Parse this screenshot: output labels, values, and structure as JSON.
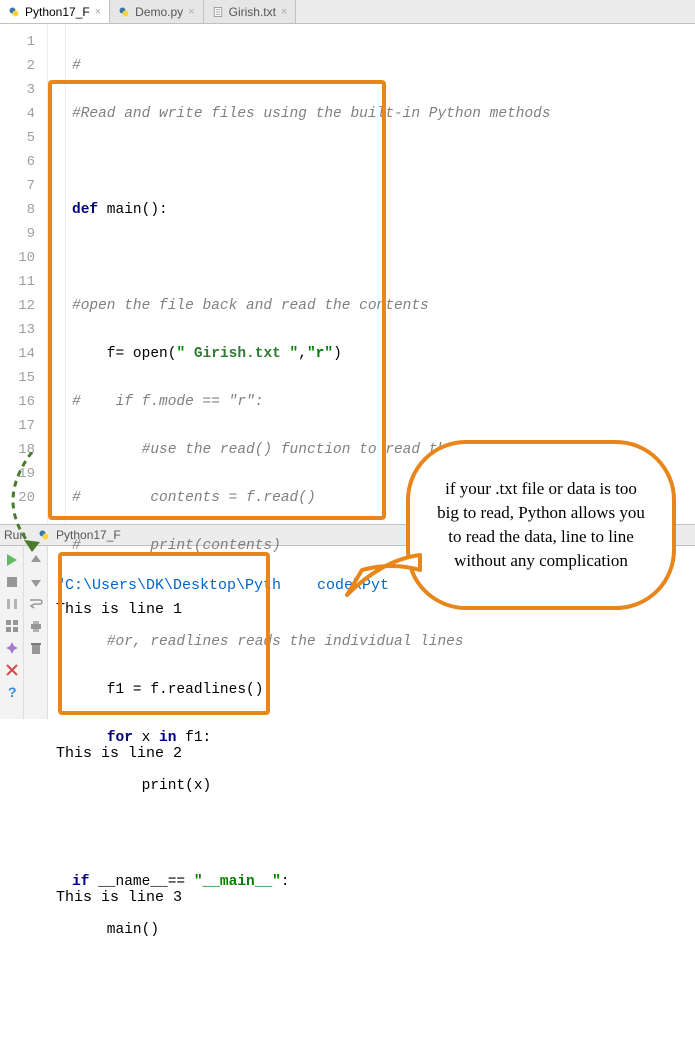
{
  "tabs": [
    {
      "label": "Python17_F",
      "kind": "py",
      "active": true
    },
    {
      "label": "Demo.py",
      "kind": "py",
      "active": false
    },
    {
      "label": "Girish.txt",
      "kind": "txt",
      "active": false
    }
  ],
  "code": {
    "l1": "#",
    "l2": "#Read and write files using the built-in Python methods",
    "l3": "",
    "l4_def": "def",
    "l4_name": " main():",
    "l5": "",
    "l6": "#open the file back and read the contents",
    "l7_a": "    f= ",
    "l7_open": "open",
    "l7_paren1": "(",
    "l7_str1": "\" ",
    "l7_file": "Girish.txt",
    "l7_str2": " \"",
    "l7_comma": ",",
    "l7_str3": "\"r\"",
    "l7_paren2": ")",
    "l8": "#    if f.mode == \"r\":",
    "l9": "        #use the read() function to read the content",
    "l10": "#        contents = f.read()",
    "l11": "#        print(contents)",
    "l12": "",
    "l13": "    #or, readlines reads the individual lines",
    "l14": "    f1 = f.readlines()",
    "l15_for": "for",
    "l15_mid": " x ",
    "l15_in": "in",
    "l15_end": " f1:",
    "l16_a": "        ",
    "l16_print": "print",
    "l16_b": "(x)",
    "l17": "",
    "l18_if": "if",
    "l18_mid": " __name__== ",
    "l18_str": "\"__main__\"",
    "l18_colon": ":",
    "l19": "    main()",
    "l20": ""
  },
  "line_numbers": [
    "1",
    "2",
    "3",
    "4",
    "5",
    "6",
    "7",
    "8",
    "9",
    "10",
    "11",
    "12",
    "13",
    "14",
    "15",
    "16",
    "17",
    "18",
    "19",
    "20"
  ],
  "run": {
    "title_prefix": "Run",
    "config_name": "Python17_F",
    "path": "\"C:\\Users\\DK\\Desktop\\Pyth    code\\Pyt",
    "out1": "This is line 1",
    "out2": "This is line 2",
    "out3": "This is line 3"
  },
  "callout_text": "if your .txt file or data is too big to read, Python allows you to read the data, line to line without any complication",
  "icons": {
    "play": "play-icon",
    "stop": "stop-icon",
    "pause": "pause-icon",
    "layout": "layout-icon",
    "pin": "pin-icon",
    "close": "close-icon",
    "help": "help-icon",
    "up": "up-arrow-icon",
    "down": "down-arrow-icon",
    "wrap": "wrap-icon",
    "print": "print-icon",
    "trash": "trash-icon"
  }
}
